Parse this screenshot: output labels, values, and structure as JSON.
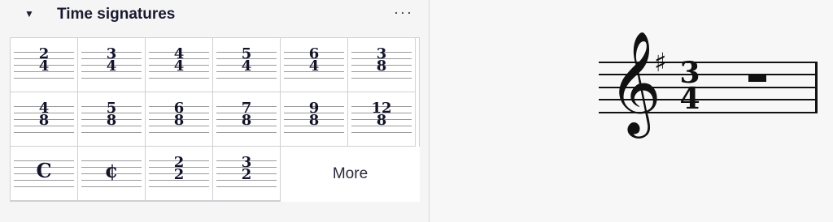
{
  "palette": {
    "title": "Time signatures",
    "menu_glyph": "···",
    "expand_glyph": "▼",
    "more_label": "More",
    "cells": [
      {
        "num": "2",
        "den": "4"
      },
      {
        "num": "3",
        "den": "4"
      },
      {
        "num": "4",
        "den": "4"
      },
      {
        "num": "5",
        "den": "4"
      },
      {
        "num": "6",
        "den": "4"
      },
      {
        "num": "3",
        "den": "8"
      },
      {
        "num": "4",
        "den": "8"
      },
      {
        "num": "5",
        "den": "8"
      },
      {
        "num": "6",
        "den": "8"
      },
      {
        "num": "7",
        "den": "8"
      },
      {
        "num": "9",
        "den": "8"
      },
      {
        "num": "12",
        "den": "8"
      },
      {
        "symbol": "C"
      },
      {
        "symbol": "¢"
      },
      {
        "num": "2",
        "den": "2"
      },
      {
        "num": "3",
        "den": "2"
      }
    ]
  },
  "score": {
    "clef": "𝄞",
    "key_accidental": "♯",
    "time_num": "3",
    "time_den": "4"
  }
}
